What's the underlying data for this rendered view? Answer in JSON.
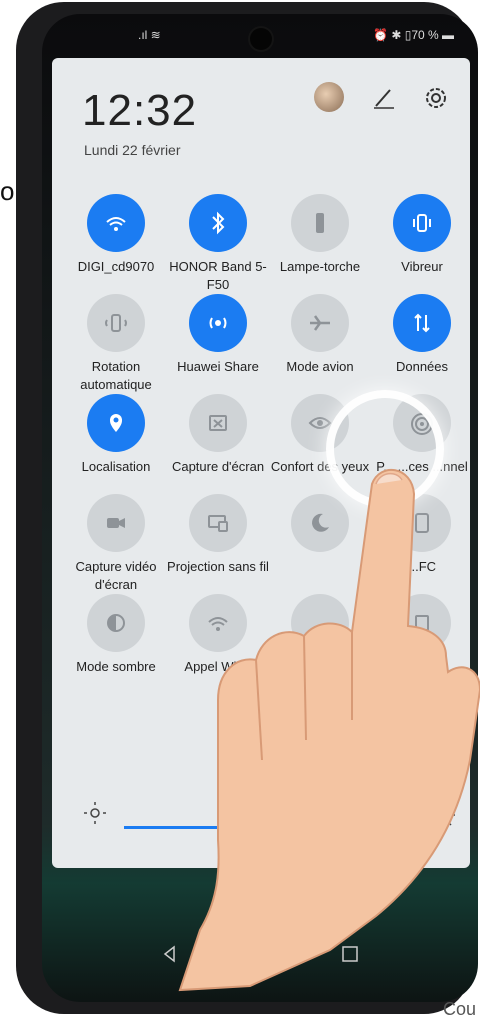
{
  "cut_text": "on",
  "status_bar": {
    "right": "⏰ ✱ ▯70 % ▬"
  },
  "header": {
    "time": "12:32",
    "date": "Lundi 22 février"
  },
  "tiles": [
    {
      "label": "DIGI_cd9070",
      "state": "on",
      "icon": "wifi-icon"
    },
    {
      "label": "HONOR Band 5-F50",
      "state": "on",
      "icon": "bluetooth-icon"
    },
    {
      "label": "Lampe-torche",
      "state": "off",
      "icon": "flashlight-icon"
    },
    {
      "label": "Vibreur",
      "state": "on",
      "icon": "vibrate-icon"
    },
    {
      "label": "Rotation automatique",
      "state": "off",
      "icon": "rotation-icon"
    },
    {
      "label": "Huawei Share",
      "state": "on",
      "icon": "share-icon"
    },
    {
      "label": "Mode avion",
      "state": "off",
      "icon": "airplane-icon"
    },
    {
      "label": "Données",
      "state": "on",
      "icon": "mobile-data-icon"
    },
    {
      "label": "Localisation",
      "state": "on",
      "icon": "location-icon"
    },
    {
      "label": "Capture d'écran",
      "state": "off",
      "icon": "screenshot-icon"
    },
    {
      "label": "Confort des yeux",
      "state": "off",
      "icon": "eye-icon"
    },
    {
      "label": "P... ...ces ...nnel",
      "state": "off",
      "icon": "hotspot-icon"
    },
    {
      "label": "Capture vidéo d'écran",
      "state": "off",
      "icon": "screen-record-icon"
    },
    {
      "label": "Projection sans fil",
      "state": "off",
      "icon": "projection-icon"
    },
    {
      "label": "",
      "state": "off",
      "icon": "moon-icon"
    },
    {
      "label": "...FC",
      "state": "off",
      "icon": "nfc-icon"
    },
    {
      "label": "Mode sombre",
      "state": "off",
      "icon": "dark-mode-icon"
    },
    {
      "label": "Appel Wi-Fi",
      "state": "off",
      "icon": "wifi-call-icon"
    },
    {
      "label": "",
      "state": "off",
      "icon": "hidden-icon"
    },
    {
      "label": "...on",
      "state": "off",
      "icon": "hidden-icon-2"
    }
  ],
  "brightness": {
    "level": 0.45
  },
  "watermark": "Cou"
}
